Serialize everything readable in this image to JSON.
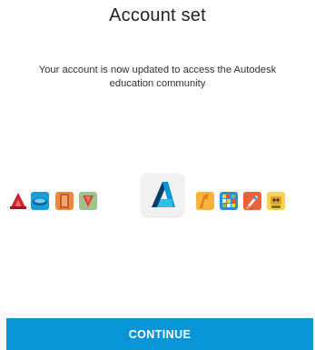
{
  "header": {
    "title": "Account set"
  },
  "message": {
    "line1": "Your account is now updated to access the Autodesk",
    "line2": "education community"
  },
  "products": {
    "icons": [
      "autocad-icon",
      "3ds-max-icon",
      "revit-icon",
      "revit-family-icon",
      "autodesk-logo-icon",
      "fusion-icon",
      "grid-app-icon",
      "rocket-app-icon",
      "robot-app-icon"
    ]
  },
  "actions": {
    "continue_label": "CONTINUE"
  },
  "colors": {
    "accent": "#0696d7",
    "text": "#222222"
  }
}
